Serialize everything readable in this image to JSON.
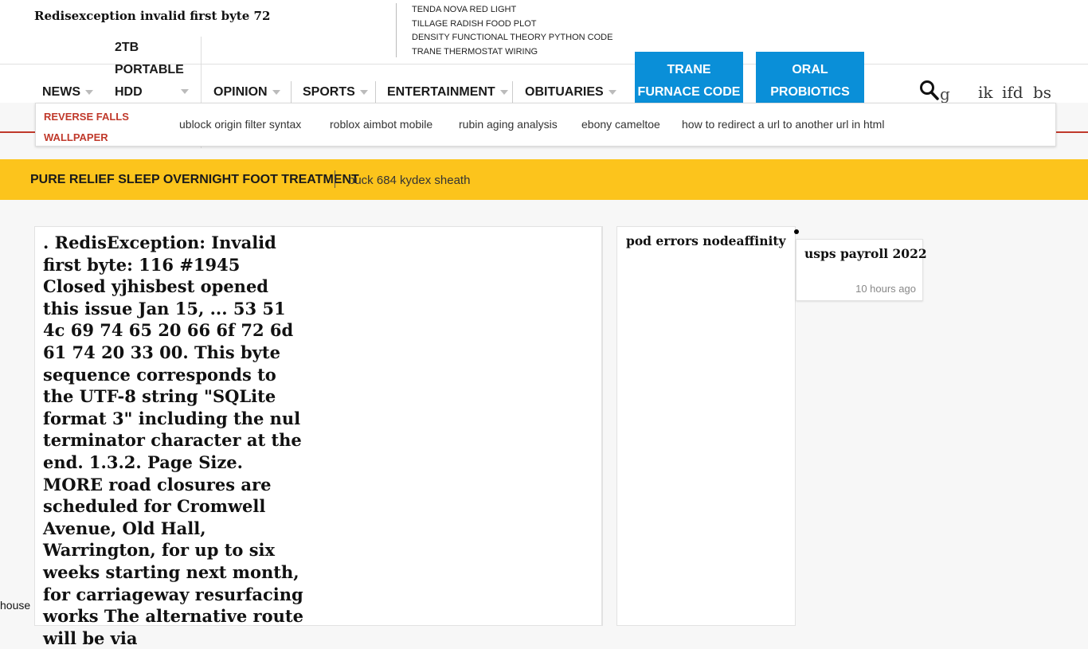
{
  "header": {
    "site_title": "Redisexception invalid first byte 72",
    "trending": [
      "TENDA NOVA RED LIGHT",
      "TILLAGE RADISH FOOD PLOT",
      "DENSITY FUNCTIONAL THEORY PYTHON CODE",
      "TRANE THERMOSTAT WIRING"
    ]
  },
  "nav": {
    "news": "NEWS",
    "hdd_lines": [
      "2TB",
      "PORTABLE",
      "HDD"
    ],
    "opinion": "OPINION",
    "sports": "SPORTS",
    "entertainment": "ENTERTAINMENT",
    "obituaries": "OBITUARIES",
    "btn1_lines": [
      "TRANE",
      "FURNACE CODE"
    ],
    "btn2_lines": [
      "ORAL",
      "PROBIOTICS"
    ],
    "search_suffix": "g",
    "mini_links": [
      "ik",
      "ifd",
      "bs"
    ]
  },
  "subnav": {
    "red_lines": [
      "REVERSE FALLS",
      "WALLPAPER"
    ],
    "links": [
      "ublock origin filter syntax",
      "roblox aimbot mobile",
      "rubin aging analysis",
      "ebony cameltoe",
      "how to redirect a url to another url in html"
    ]
  },
  "ticker": {
    "main": "PURE RELIEF SLEEP OVERNIGHT FOOT TREATMENT",
    "sub": "buck 684 kydex sheath"
  },
  "article": {
    "text": ". RedisException: Invalid first byte: 116 #1945 Closed yjhisbest opened this issue Jan 15, ... 53 51 4c 69 74 65 20 66 6f 72 6d 61 74 20 33 00. This byte sequence corresponds to the UTF-8 string \"SQLite format 3\" including the nul terminator character at the end. 1.3.2. Page Size. MORE road closures are scheduled for Cromwell Avenue, Old Hall, Warrington, for up to six weeks starting next month, for carriageway resurfacing works The alternative route will be via"
  },
  "sidebar": {
    "card1_title": "pod errors nodeaffinity",
    "card2_title": "usps payroll 2022",
    "card2_time": "10 hours ago"
  },
  "corner_text": "house",
  "colors": {
    "accent_blue": "#0a8fd8",
    "ticker_yellow": "#fcc41c",
    "nav_red": "#c0392b"
  }
}
